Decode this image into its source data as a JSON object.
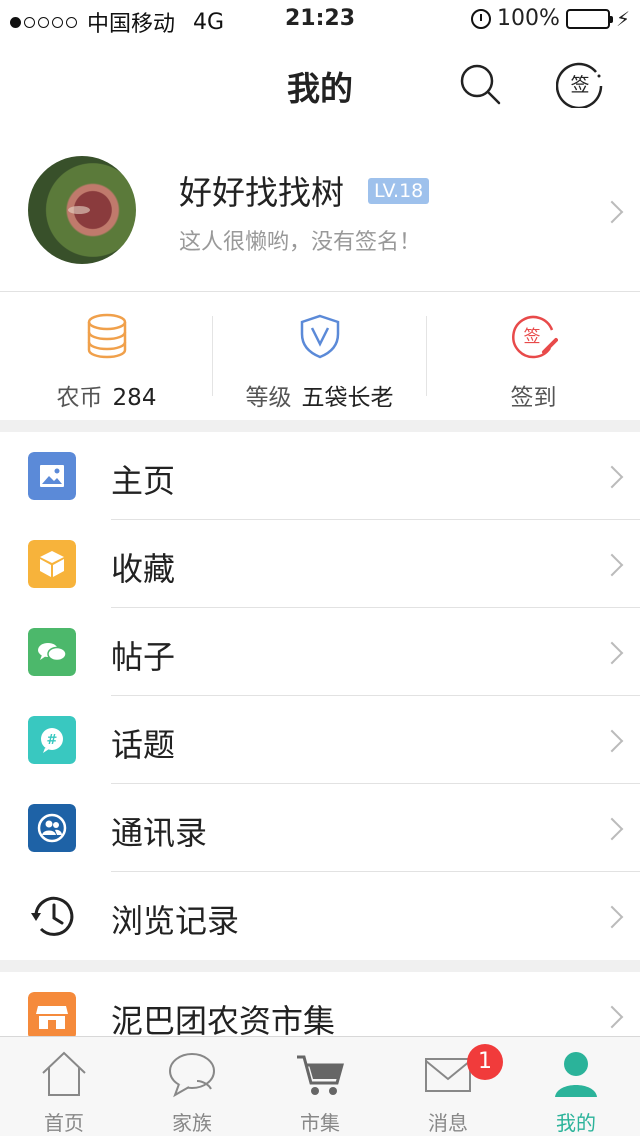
{
  "status_bar": {
    "carrier": "中国移动",
    "network": "4G",
    "time": "21:23",
    "battery": "100%"
  },
  "nav": {
    "title": "我的",
    "sign_icon_text": "签"
  },
  "profile": {
    "name": "好好找找树",
    "level": "LV.18",
    "signature": "这人很懒哟，没有签名！"
  },
  "stats": [
    {
      "label": "农币",
      "value": "284",
      "icon": "coins-icon"
    },
    {
      "label": "等级",
      "value": "五袋长老",
      "icon": "level-shield-icon"
    },
    {
      "label": "签到",
      "value": "",
      "icon": "checkin-icon"
    }
  ],
  "menu": [
    {
      "label": "主页",
      "icon": "image-icon",
      "color": "#5b8ad8"
    },
    {
      "label": "收藏",
      "icon": "box-icon",
      "color": "#f7b33b"
    },
    {
      "label": "帖子",
      "icon": "chat-bubbles-icon",
      "color": "#4cb86b"
    },
    {
      "label": "话题",
      "icon": "hashtag-bubble-icon",
      "color": "#39c8c0"
    },
    {
      "label": "通讯录",
      "icon": "contacts-icon",
      "color": "#1e62a6"
    },
    {
      "label": "浏览记录",
      "icon": "history-clock-icon",
      "color": "#ffffff"
    }
  ],
  "menu2": [
    {
      "label": "泥巴团农资市集",
      "icon": "store-icon",
      "color": "#f58a3b"
    }
  ],
  "tabbar": {
    "tabs": [
      {
        "label": "首页",
        "icon": "home-icon"
      },
      {
        "label": "家族",
        "icon": "chat-icon"
      },
      {
        "label": "市集",
        "icon": "cart-icon"
      },
      {
        "label": "消息",
        "icon": "mail-icon"
      },
      {
        "label": "我的",
        "icon": "person-icon"
      }
    ],
    "message_badge": "1",
    "active_color": "#2bb39a"
  }
}
